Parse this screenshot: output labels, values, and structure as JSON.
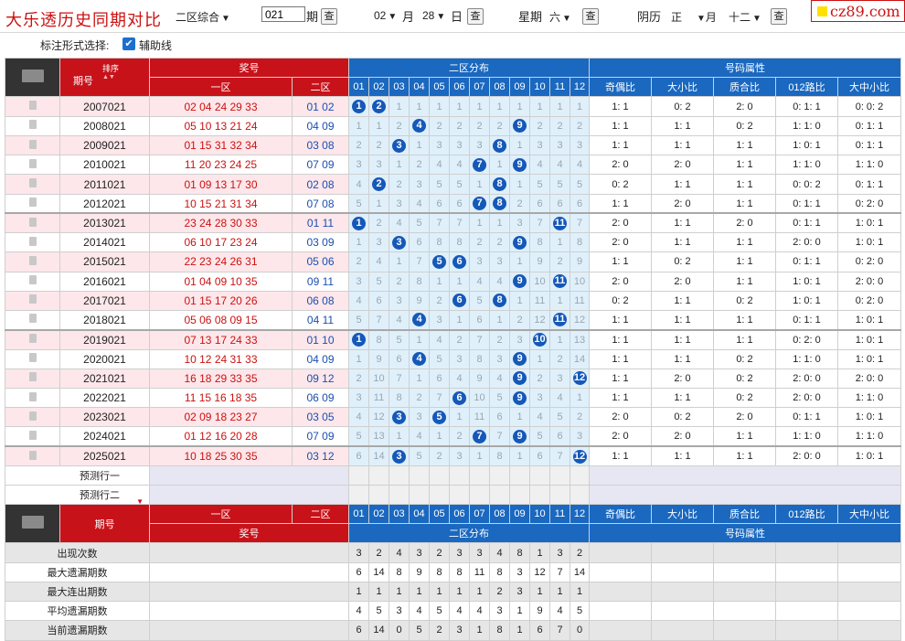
{
  "header": {
    "title": "大乐透历史同期对比",
    "zone_select": "二区综合",
    "issue_input": "021",
    "issue_suffix": "期",
    "month_value": "02",
    "month_label": "月",
    "day_value": "28",
    "day_label": "日",
    "weekday_label": "星期",
    "weekday_value": "六",
    "lunar_label": "阴历",
    "lunar_month": "正",
    "lunar_month_suffix": "月",
    "lunar_day": "十二",
    "query_label": "查",
    "logo": "cz89.com"
  },
  "options": {
    "label": "标注形式选择:",
    "aux_line": "辅助线"
  },
  "columns": {
    "issue": "期号",
    "sort": "排序",
    "prize": "奖号",
    "zone1": "一区",
    "zone2": "二区",
    "dist": "二区分布",
    "attr": "号码属性",
    "nums": [
      "01",
      "02",
      "03",
      "04",
      "05",
      "06",
      "07",
      "08",
      "09",
      "10",
      "11",
      "12"
    ],
    "attrs": [
      "奇偶比",
      "大小比",
      "质合比",
      "012路比",
      "大中小比"
    ]
  },
  "rows": [
    {
      "issue": "2007021",
      "z1": "02 04 24 29 33",
      "z2": "01 02",
      "dist": [
        "1",
        "2",
        "1",
        "1",
        "1",
        "1",
        "1",
        "1",
        "1",
        "1",
        "1",
        "1"
      ],
      "hits": [
        1,
        2
      ],
      "attr": [
        "1: 1",
        "0: 2",
        "2: 0",
        "0: 1: 1",
        "0: 0: 2"
      ]
    },
    {
      "issue": "2008021",
      "z1": "05 10 13 21 24",
      "z2": "04 09",
      "dist": [
        "1",
        "1",
        "2",
        "4",
        "2",
        "2",
        "2",
        "2",
        "9",
        "2",
        "2",
        "2"
      ],
      "hits": [
        4,
        9
      ],
      "attr": [
        "1: 1",
        "1: 1",
        "0: 2",
        "1: 1: 0",
        "0: 1: 1"
      ]
    },
    {
      "issue": "2009021",
      "z1": "01 15 31 32 34",
      "z2": "03 08",
      "dist": [
        "2",
        "2",
        "3",
        "1",
        "3",
        "3",
        "3",
        "8",
        "1",
        "3",
        "3",
        "3"
      ],
      "hits": [
        3,
        8
      ],
      "attr": [
        "1: 1",
        "1: 1",
        "1: 1",
        "1: 0: 1",
        "0: 1: 1"
      ]
    },
    {
      "issue": "2010021",
      "z1": "11 20 23 24 25",
      "z2": "07 09",
      "dist": [
        "3",
        "3",
        "1",
        "2",
        "4",
        "4",
        "7",
        "1",
        "9",
        "4",
        "4",
        "4"
      ],
      "hits": [
        7,
        9
      ],
      "attr": [
        "2: 0",
        "2: 0",
        "1: 1",
        "1: 1: 0",
        "1: 1: 0"
      ]
    },
    {
      "issue": "2011021",
      "z1": "01 09 13 17 30",
      "z2": "02 08",
      "dist": [
        "4",
        "2",
        "2",
        "3",
        "5",
        "5",
        "1",
        "8",
        "1",
        "5",
        "5",
        "5"
      ],
      "hits": [
        2,
        8
      ],
      "attr": [
        "0: 2",
        "1: 1",
        "1: 1",
        "0: 0: 2",
        "0: 1: 1"
      ]
    },
    {
      "issue": "2012021",
      "z1": "10 15 21 31 34",
      "z2": "07 08",
      "dist": [
        "5",
        "1",
        "3",
        "4",
        "6",
        "6",
        "7",
        "8",
        "2",
        "6",
        "6",
        "6"
      ],
      "hits": [
        7,
        8
      ],
      "attr": [
        "1: 1",
        "2: 0",
        "1: 1",
        "0: 1: 1",
        "0: 2: 0"
      ]
    },
    {
      "issue": "2013021",
      "z1": "23 24 28 30 33",
      "z2": "01 11",
      "dist": [
        "1",
        "2",
        "4",
        "5",
        "7",
        "7",
        "1",
        "1",
        "3",
        "7",
        "11",
        "7"
      ],
      "hits": [
        1,
        11
      ],
      "attr": [
        "2: 0",
        "1: 1",
        "2: 0",
        "0: 1: 1",
        "1: 0: 1"
      ]
    },
    {
      "issue": "2014021",
      "z1": "06 10 17 23 24",
      "z2": "03 09",
      "dist": [
        "1",
        "3",
        "3",
        "6",
        "8",
        "8",
        "2",
        "2",
        "9",
        "8",
        "1",
        "8"
      ],
      "hits": [
        3,
        9
      ],
      "attr": [
        "2: 0",
        "1: 1",
        "1: 1",
        "2: 0: 0",
        "1: 0: 1"
      ]
    },
    {
      "issue": "2015021",
      "z1": "22 23 24 26 31",
      "z2": "05 06",
      "dist": [
        "2",
        "4",
        "1",
        "7",
        "5",
        "6",
        "3",
        "3",
        "1",
        "9",
        "2",
        "9"
      ],
      "hits": [
        5,
        6
      ],
      "attr": [
        "1: 1",
        "0: 2",
        "1: 1",
        "0: 1: 1",
        "0: 2: 0"
      ]
    },
    {
      "issue": "2016021",
      "z1": "01 04 09 10 35",
      "z2": "09 11",
      "dist": [
        "3",
        "5",
        "2",
        "8",
        "1",
        "1",
        "4",
        "4",
        "9",
        "10",
        "11",
        "10"
      ],
      "hits": [
        9,
        11
      ],
      "attr": [
        "2: 0",
        "2: 0",
        "1: 1",
        "1: 0: 1",
        "2: 0: 0"
      ]
    },
    {
      "issue": "2017021",
      "z1": "01 15 17 20 26",
      "z2": "06 08",
      "dist": [
        "4",
        "6",
        "3",
        "9",
        "2",
        "6",
        "5",
        "8",
        "1",
        "11",
        "1",
        "11"
      ],
      "hits": [
        6,
        8
      ],
      "attr": [
        "0: 2",
        "1: 1",
        "0: 2",
        "1: 0: 1",
        "0: 2: 0"
      ]
    },
    {
      "issue": "2018021",
      "z1": "05 06 08 09 15",
      "z2": "04 11",
      "dist": [
        "5",
        "7",
        "4",
        "4",
        "3",
        "1",
        "6",
        "1",
        "2",
        "12",
        "11",
        "12"
      ],
      "hits": [
        4,
        11
      ],
      "attr": [
        "1: 1",
        "1: 1",
        "1: 1",
        "0: 1: 1",
        "1: 0: 1"
      ]
    },
    {
      "issue": "2019021",
      "z1": "07 13 17 24 33",
      "z2": "01 10",
      "dist": [
        "1",
        "8",
        "5",
        "1",
        "4",
        "2",
        "7",
        "2",
        "3",
        "10",
        "1",
        "13"
      ],
      "hits": [
        1,
        10
      ],
      "attr": [
        "1: 1",
        "1: 1",
        "1: 1",
        "0: 2: 0",
        "1: 0: 1"
      ]
    },
    {
      "issue": "2020021",
      "z1": "10 12 24 31 33",
      "z2": "04 09",
      "dist": [
        "1",
        "9",
        "6",
        "4",
        "5",
        "3",
        "8",
        "3",
        "9",
        "1",
        "2",
        "14"
      ],
      "hits": [
        4,
        9
      ],
      "attr": [
        "1: 1",
        "1: 1",
        "0: 2",
        "1: 1: 0",
        "1: 0: 1"
      ]
    },
    {
      "issue": "2021021",
      "z1": "16 18 29 33 35",
      "z2": "09 12",
      "dist": [
        "2",
        "10",
        "7",
        "1",
        "6",
        "4",
        "9",
        "4",
        "9",
        "2",
        "3",
        "12"
      ],
      "hits": [
        9,
        12
      ],
      "attr": [
        "1: 1",
        "2: 0",
        "0: 2",
        "2: 0: 0",
        "2: 0: 0"
      ]
    },
    {
      "issue": "2022021",
      "z1": "11 15 16 18 35",
      "z2": "06 09",
      "dist": [
        "3",
        "11",
        "8",
        "2",
        "7",
        "6",
        "10",
        "5",
        "9",
        "3",
        "4",
        "1"
      ],
      "hits": [
        6,
        9
      ],
      "attr": [
        "1: 1",
        "1: 1",
        "0: 2",
        "2: 0: 0",
        "1: 1: 0"
      ]
    },
    {
      "issue": "2023021",
      "z1": "02 09 18 23 27",
      "z2": "03 05",
      "dist": [
        "4",
        "12",
        "3",
        "3",
        "5",
        "1",
        "11",
        "6",
        "1",
        "4",
        "5",
        "2"
      ],
      "hits": [
        3,
        5
      ],
      "attr": [
        "2: 0",
        "0: 2",
        "2: 0",
        "0: 1: 1",
        "1: 0: 1"
      ]
    },
    {
      "issue": "2024021",
      "z1": "01 12 16 20 28",
      "z2": "07 09",
      "dist": [
        "5",
        "13",
        "1",
        "4",
        "1",
        "2",
        "7",
        "7",
        "9",
        "5",
        "6",
        "3"
      ],
      "hits": [
        7,
        9
      ],
      "attr": [
        "2: 0",
        "2: 0",
        "1: 1",
        "1: 1: 0",
        "1: 1: 0"
      ]
    },
    {
      "issue": "2025021",
      "z1": "10 18 25 30 35",
      "z2": "03 12",
      "dist": [
        "6",
        "14",
        "3",
        "5",
        "2",
        "3",
        "1",
        "8",
        "1",
        "6",
        "7",
        "12"
      ],
      "hits": [
        3,
        12
      ],
      "attr": [
        "1: 1",
        "1: 1",
        "1: 1",
        "2: 0: 0",
        "1: 0: 1"
      ]
    }
  ],
  "pred": [
    "预测行一",
    "预测行二"
  ],
  "stats": [
    {
      "label": "出现次数",
      "vals": [
        "3",
        "2",
        "4",
        "3",
        "2",
        "3",
        "3",
        "4",
        "8",
        "1",
        "3",
        "2"
      ]
    },
    {
      "label": "最大遗漏期数",
      "vals": [
        "6",
        "14",
        "8",
        "9",
        "8",
        "8",
        "11",
        "8",
        "3",
        "12",
        "7",
        "14"
      ]
    },
    {
      "label": "最大连出期数",
      "vals": [
        "1",
        "1",
        "1",
        "1",
        "1",
        "1",
        "1",
        "2",
        "3",
        "1",
        "1",
        "1"
      ]
    },
    {
      "label": "平均遗漏期数",
      "vals": [
        "4",
        "5",
        "3",
        "4",
        "5",
        "4",
        "4",
        "3",
        "1",
        "9",
        "4",
        "5"
      ]
    },
    {
      "label": "当前遗漏期数",
      "vals": [
        "6",
        "14",
        "0",
        "5",
        "2",
        "3",
        "1",
        "8",
        "1",
        "6",
        "7",
        "0"
      ]
    }
  ],
  "colors": {
    "red": "#c8121a",
    "blue": "#1a68c0",
    "ball": "#1558b8",
    "pink_row": "#fde7ea",
    "dist_bg": "#dff0fb"
  }
}
